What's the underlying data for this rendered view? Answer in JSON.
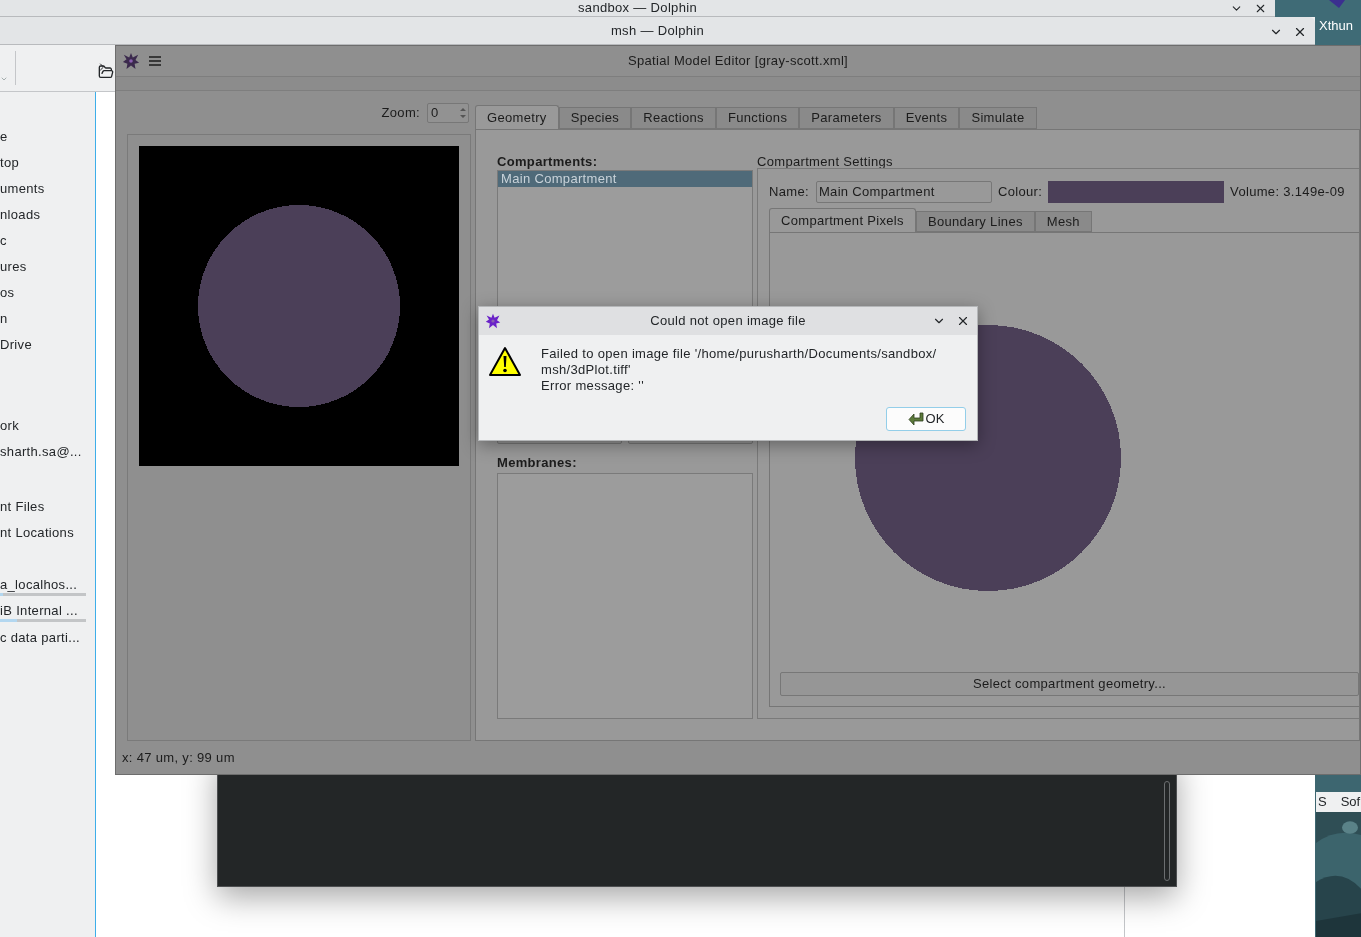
{
  "desktop": {
    "icon_label": "Xthun"
  },
  "back_window": {
    "title": "sandbox — Dolphin"
  },
  "file_manager": {
    "title": "msh — Dolphin",
    "places": [
      {
        "items": [
          {
            "label": "e"
          },
          {
            "label": "top"
          },
          {
            "label": "uments"
          },
          {
            "label": "nloads"
          },
          {
            "label": "c"
          },
          {
            "label": "ures"
          },
          {
            "label": "os"
          },
          {
            "label": "n"
          },
          {
            "label": "Drive"
          }
        ]
      },
      {
        "items": [
          {
            "label": "ork"
          },
          {
            "label": "sharth.sa@..."
          }
        ]
      },
      {
        "items": [
          {
            "label": "nt Files"
          },
          {
            "label": "nt Locations"
          }
        ]
      },
      {
        "items": [
          {
            "label": "a_localhos...",
            "level": 0.03
          },
          {
            "label": "iB Internal ...",
            "level": 0.2
          },
          {
            "label": "c data parti..."
          }
        ]
      }
    ],
    "side_tabs": [
      "S",
      "Sof"
    ]
  },
  "editor": {
    "title": "Spatial Model Editor [gray-scott.xml]",
    "zoom": {
      "label": "Zoom:",
      "value": "0"
    },
    "tabs": [
      {
        "label": "Geometry",
        "selected": true
      },
      {
        "label": "Species",
        "selected": false
      },
      {
        "label": "Reactions",
        "selected": false
      },
      {
        "label": "Functions",
        "selected": false
      },
      {
        "label": "Parameters",
        "selected": false
      },
      {
        "label": "Events",
        "selected": false
      },
      {
        "label": "Simulate",
        "selected": false
      }
    ],
    "compartments": {
      "label": "Compartments:",
      "items": [
        {
          "label": "Main Compartment",
          "selected": true
        }
      ]
    },
    "membranes": {
      "label": "Membranes:"
    },
    "settings": {
      "title": "Compartment Settings",
      "name_label": "Name:",
      "name_value": "Main Compartment",
      "colour_label": "Colour:",
      "colour_swatch": {
        "color": "#4b3f58"
      },
      "volume": "Volume: 3.149e-09",
      "subtabs": [
        {
          "label": "Compartment Pixels",
          "selected": true
        },
        {
          "label": "Boundary Lines",
          "selected": false
        },
        {
          "label": "Mesh",
          "selected": false
        }
      ],
      "select_button": "Select compartment geometry..."
    },
    "status": "x: 47 um, y: 99 um"
  },
  "dialog": {
    "title": "Could not open image file",
    "message": [
      "Failed to open image file '/home/purusharth/Documents/sandbox/",
      "msh/3dPlot.tiff'",
      "Error message: ''"
    ],
    "button": "OK"
  }
}
